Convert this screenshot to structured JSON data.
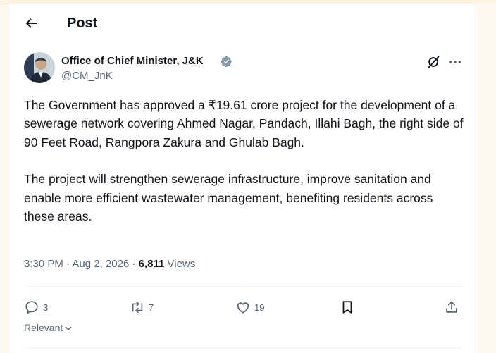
{
  "header": {
    "title": "Post"
  },
  "author": {
    "name": "Office of Chief Minister, J&K",
    "handle": "@CM_JnK"
  },
  "post": {
    "paragraphs": [
      "The Government has approved a ₹19.61 crore project for the development of a sewerage network covering Ahmed Nagar, Pandach, Illahi Bagh, the right side of 90 Feet Road, Rangpora Zakura and Ghulab Bagh.",
      "The project will strengthen sewerage infrastructure, improve sanitation and enable more efficient wastewater management, benefiting residents across these areas."
    ],
    "time": "3:30 PM · Aug 2, 2026",
    "separator": "·",
    "views_count": "6,811",
    "views_label": "Views"
  },
  "actions": {
    "replies": "3",
    "reposts": "7",
    "likes": "19"
  },
  "sort": {
    "label": "Relevant"
  },
  "icons": {
    "back": "arrow-left-icon",
    "verified": "verified-badge-icon",
    "grok": "grok-icon",
    "more": "more-horizontal-icon",
    "reply": "reply-icon",
    "repost": "repost-icon",
    "like": "heart-icon",
    "bookmark": "bookmark-icon",
    "share": "share-icon",
    "chevron": "chevron-down-icon"
  },
  "colors": {
    "verified": "#829aab",
    "muted": "#536471",
    "text": "#0f1419"
  }
}
